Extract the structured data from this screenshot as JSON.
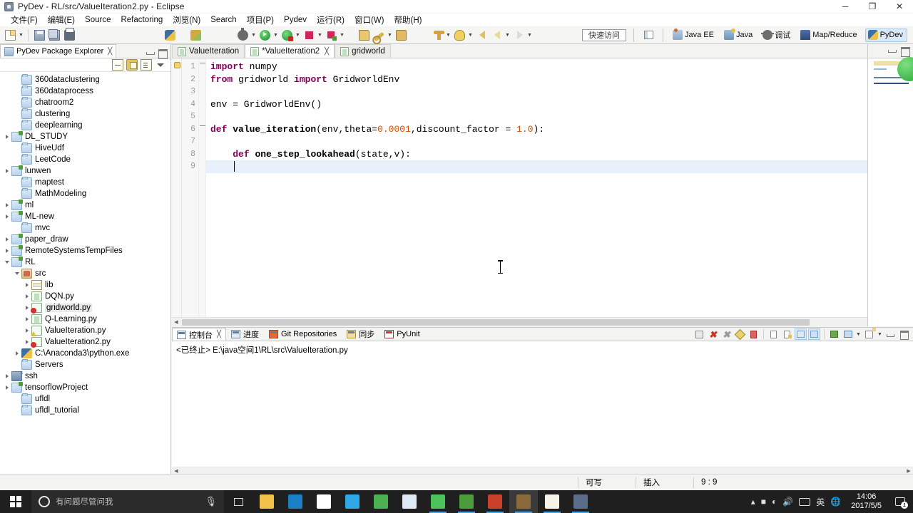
{
  "window": {
    "title": "PyDev - RL/src/ValueIteration2.py - Eclipse",
    "minimize": "─",
    "restore": "❐",
    "close": "✕"
  },
  "menu": {
    "items": [
      {
        "label": "文件(F)"
      },
      {
        "label": "编辑(E)"
      },
      {
        "label": "Source"
      },
      {
        "label": "Refactoring"
      },
      {
        "label": "浏览(N)"
      },
      {
        "label": "Search"
      },
      {
        "label": "项目(P)"
      },
      {
        "label": "Pydev"
      },
      {
        "label": "运行(R)"
      },
      {
        "label": "窗口(W)"
      },
      {
        "label": "帮助(H)"
      }
    ]
  },
  "toolbar": {
    "quick_access_placeholder": "快速访问",
    "buttons": [
      {
        "name": "new-wizard",
        "icon": "new-document-icon"
      },
      {
        "name": "save",
        "icon": "save-icon"
      },
      {
        "name": "save-all",
        "icon": "save-all-icon"
      },
      {
        "name": "print",
        "icon": "print-icon"
      },
      {
        "name": "new-pydev-project",
        "icon": "python-project-icon"
      },
      {
        "name": "new-pydev-package",
        "icon": "python-package-icon"
      },
      {
        "name": "debug",
        "icon": "debug-bug-icon"
      },
      {
        "name": "run",
        "icon": "run-green-play-icon"
      },
      {
        "name": "run-external-tools",
        "icon": "run-external-icon"
      },
      {
        "name": "terminate",
        "icon": "stop-square-icon"
      },
      {
        "name": "coverage",
        "icon": "coverage-icon"
      },
      {
        "name": "open-type",
        "icon": "open-folder-icon"
      },
      {
        "name": "search",
        "icon": "search-icon"
      },
      {
        "name": "open-resource",
        "icon": "open-box-icon"
      },
      {
        "name": "previous-annotation",
        "icon": "down-anchor-icon"
      },
      {
        "name": "next-annotation",
        "icon": "up-anchor-icon"
      },
      {
        "name": "back",
        "icon": "back-arrow-icon"
      },
      {
        "name": "back-history",
        "icon": "back-arrow-secondary-icon"
      },
      {
        "name": "forward",
        "icon": "forward-arrow-icon"
      }
    ]
  },
  "perspectives": {
    "items": [
      {
        "label": "Java EE",
        "icon": "java-ee-icon",
        "active": false
      },
      {
        "label": "Java",
        "icon": "java-icon",
        "active": false
      },
      {
        "label": "调试",
        "icon": "debug-icon",
        "active": false
      },
      {
        "label": "Map/Reduce",
        "icon": "map-reduce-icon",
        "active": false
      },
      {
        "label": "PyDev",
        "icon": "pydev-icon",
        "active": true
      }
    ]
  },
  "explorer": {
    "tab_label": "PyDev Package Explorer",
    "tab_close": "╳",
    "toolbar": [
      {
        "name": "collapse-all-button",
        "icon": "collapse-all-icon"
      },
      {
        "name": "link-with-editor-button",
        "icon": "link-editor-icon"
      },
      {
        "name": "filter-button",
        "icon": "filter-icon"
      },
      {
        "name": "view-menu-button",
        "icon": "chevron-down-icon"
      }
    ],
    "tree": [
      {
        "label": "360dataclustering",
        "indent": 1,
        "twist": "none",
        "icon": "folder-icon"
      },
      {
        "label": "360dataprocess",
        "indent": 1,
        "twist": "none",
        "icon": "folder-icon"
      },
      {
        "label": "chatroom2",
        "indent": 1,
        "twist": "none",
        "icon": "folder-icon"
      },
      {
        "label": "clustering",
        "indent": 1,
        "twist": "none",
        "icon": "folder-icon"
      },
      {
        "label": "deeplearning",
        "indent": 1,
        "twist": "none",
        "icon": "folder-icon"
      },
      {
        "label": "DL_STUDY",
        "indent": 0,
        "twist": "collapsed",
        "icon": "project-folder-icon"
      },
      {
        "label": "HiveUdf",
        "indent": 1,
        "twist": "none",
        "icon": "folder-icon"
      },
      {
        "label": "LeetCode",
        "indent": 1,
        "twist": "none",
        "icon": "folder-icon"
      },
      {
        "label": "lunwen",
        "indent": 0,
        "twist": "collapsed",
        "icon": "project-folder-icon"
      },
      {
        "label": "maptest",
        "indent": 1,
        "twist": "none",
        "icon": "folder-icon"
      },
      {
        "label": "MathModeling",
        "indent": 1,
        "twist": "none",
        "icon": "folder-icon"
      },
      {
        "label": "ml",
        "indent": 0,
        "twist": "collapsed",
        "icon": "project-folder-icon"
      },
      {
        "label": "ML-new",
        "indent": 0,
        "twist": "collapsed",
        "icon": "project-folder-icon"
      },
      {
        "label": "mvc",
        "indent": 1,
        "twist": "none",
        "icon": "folder-icon"
      },
      {
        "label": "paper_draw",
        "indent": 0,
        "twist": "collapsed",
        "icon": "project-folder-icon"
      },
      {
        "label": "RemoteSystemsTempFiles",
        "indent": 0,
        "twist": "collapsed",
        "icon": "project-folder-icon"
      },
      {
        "label": "RL",
        "indent": 0,
        "twist": "expanded",
        "icon": "project-folder-icon"
      },
      {
        "label": "src",
        "indent": 1,
        "twist": "expanded",
        "icon": "source-folder-icon"
      },
      {
        "label": "lib",
        "indent": 2,
        "twist": "collapsed",
        "icon": "library-icon"
      },
      {
        "label": "DQN.py",
        "indent": 2,
        "twist": "collapsed",
        "icon": "python-file-icon"
      },
      {
        "label": "gridworld.py",
        "indent": 2,
        "twist": "collapsed",
        "icon": "python-file-error-icon",
        "selected": true
      },
      {
        "label": "Q-Learning.py",
        "indent": 2,
        "twist": "collapsed",
        "icon": "python-file-icon"
      },
      {
        "label": "ValueIteration.py",
        "indent": 2,
        "twist": "collapsed",
        "icon": "python-file-warning-icon"
      },
      {
        "label": "ValueIteration2.py",
        "indent": 2,
        "twist": "collapsed",
        "icon": "python-file-error-icon"
      },
      {
        "label": "C:\\Anaconda3\\python.exe",
        "indent": 1,
        "twist": "collapsed",
        "icon": "python-interpreter-icon"
      },
      {
        "label": "Servers",
        "indent": 1,
        "twist": "none",
        "icon": "folder-icon"
      },
      {
        "label": "ssh",
        "indent": 0,
        "twist": "collapsed",
        "icon": "ssh-folder-icon"
      },
      {
        "label": "tensorflowProject",
        "indent": 0,
        "twist": "collapsed",
        "icon": "project-folder-icon"
      },
      {
        "label": "ufldl",
        "indent": 1,
        "twist": "none",
        "icon": "folder-icon"
      },
      {
        "label": "ufldl_tutorial",
        "indent": 1,
        "twist": "none",
        "icon": "folder-icon"
      }
    ]
  },
  "editor": {
    "tabs": [
      {
        "label": "ValueIteration",
        "active": false,
        "dirty": false,
        "close": ""
      },
      {
        "label": "*ValueIteration2",
        "active": true,
        "dirty": true,
        "close": "╳"
      },
      {
        "label": "gridworld",
        "active": false,
        "dirty": false,
        "close": ""
      }
    ],
    "line_numbers": [
      "1",
      "2",
      "3",
      "4",
      "5",
      "6",
      "7",
      "8",
      "9"
    ],
    "lines": [
      {
        "n": 1,
        "fold": "minus",
        "tokens": [
          {
            "t": "import",
            "c": "kw"
          },
          {
            "t": " numpy",
            "c": ""
          }
        ]
      },
      {
        "n": 2,
        "fold": "",
        "tokens": [
          {
            "t": "from",
            "c": "kw"
          },
          {
            "t": " gridworld ",
            "c": ""
          },
          {
            "t": "import",
            "c": "kw"
          },
          {
            "t": " GridworldEnv",
            "c": ""
          }
        ]
      },
      {
        "n": 3,
        "fold": "",
        "tokens": []
      },
      {
        "n": 4,
        "fold": "",
        "tokens": [
          {
            "t": "env = GridworldEnv()",
            "c": ""
          }
        ]
      },
      {
        "n": 5,
        "fold": "",
        "tokens": []
      },
      {
        "n": 6,
        "fold": "minus",
        "tokens": [
          {
            "t": "def ",
            "c": "kwdef"
          },
          {
            "t": "value_iteration",
            "c": "fn"
          },
          {
            "t": "(env,theta=",
            "c": ""
          },
          {
            "t": "0.0001",
            "c": "num"
          },
          {
            "t": ",discount_factor = ",
            "c": ""
          },
          {
            "t": "1.0",
            "c": "num"
          },
          {
            "t": "):",
            "c": ""
          }
        ]
      },
      {
        "n": 7,
        "fold": "",
        "tokens": []
      },
      {
        "n": 8,
        "fold": "",
        "tokens": [
          {
            "t": "    ",
            "c": ""
          },
          {
            "t": "def ",
            "c": "kwdef"
          },
          {
            "t": "one_step_lookahead",
            "c": "fn"
          },
          {
            "t": "(state,v):",
            "c": ""
          }
        ]
      },
      {
        "n": 9,
        "fold": "",
        "tokens": [],
        "current": true
      }
    ]
  },
  "console": {
    "tabs": [
      {
        "label": "控制台",
        "active": true,
        "icon": "console-icon",
        "close": "╳"
      },
      {
        "label": "进度",
        "active": false,
        "icon": "progress-icon",
        "close": ""
      },
      {
        "label": "Git Repositories",
        "active": false,
        "icon": "git-icon",
        "close": ""
      },
      {
        "label": "同步",
        "active": false,
        "icon": "sync-icon",
        "close": ""
      },
      {
        "label": "PyUnit",
        "active": false,
        "icon": "pyunit-icon",
        "close": ""
      }
    ],
    "output": "<已终止> E:\\java空间1\\RL\\src\\ValueIteration.py",
    "toolbar": [
      {
        "name": "terminate-button",
        "icon": "stop-square-icon"
      },
      {
        "name": "remove-launch-button",
        "icon": "remove-x-icon"
      },
      {
        "name": "remove-all-button",
        "icon": "remove-all-xx-icon"
      },
      {
        "name": "pin-console-button",
        "icon": "pin-icon"
      },
      {
        "name": "copy-button",
        "icon": "copy-icon"
      },
      {
        "name": "clear-console-button",
        "icon": "clear-console-icon"
      },
      {
        "name": "word-wrap-button",
        "icon": "word-wrap-icon"
      },
      {
        "name": "scroll-lock-button",
        "icon": "scroll-lock-icon"
      },
      {
        "name": "pin-output-button",
        "icon": "pin-output-icon"
      },
      {
        "name": "display-selected-button",
        "icon": "display-console-icon"
      },
      {
        "name": "open-console-button",
        "icon": "open-console-icon"
      },
      {
        "name": "new-console-button",
        "icon": "new-console-icon"
      },
      {
        "name": "minimize-button",
        "icon": "minimize-icon"
      },
      {
        "name": "maximize-button",
        "icon": "maximize-icon"
      }
    ]
  },
  "statusbar": {
    "writable": "可写",
    "insert_mode": "插入",
    "cursor_position": "9 : 9"
  },
  "taskbar": {
    "cortana_placeholder": "有问题尽管问我",
    "apps": [
      {
        "name": "file-explorer",
        "color": "#f2c14b",
        "running": false
      },
      {
        "name": "microsoft-edge",
        "color": "#1b7fc4",
        "running": false
      },
      {
        "name": "microsoft-store",
        "color": "#ffffff",
        "running": false
      },
      {
        "name": "tim-messenger",
        "color": "#2fa8e8",
        "running": false
      },
      {
        "name": "google-chrome",
        "color": "#4caf50",
        "running": false
      },
      {
        "name": "foxmail",
        "color": "#dfe9f5",
        "running": false
      },
      {
        "name": "wechat",
        "color": "#4ec25a",
        "running": true
      },
      {
        "name": "youdao-note",
        "color": "#4c9c3c",
        "running": true
      },
      {
        "name": "powerpoint",
        "color": "#c9412a",
        "running": true
      },
      {
        "name": "sublime-text",
        "color": "#8a6a3a",
        "running": true
      },
      {
        "name": "eclipse-ide",
        "color": "#f5f2e8",
        "running": true
      },
      {
        "name": "network-tool",
        "color": "#5a6d8a",
        "running": true
      }
    ],
    "tray": {
      "input_method": "英",
      "time": "14:06",
      "date": "2017/5/5",
      "notification_count": "1"
    }
  }
}
